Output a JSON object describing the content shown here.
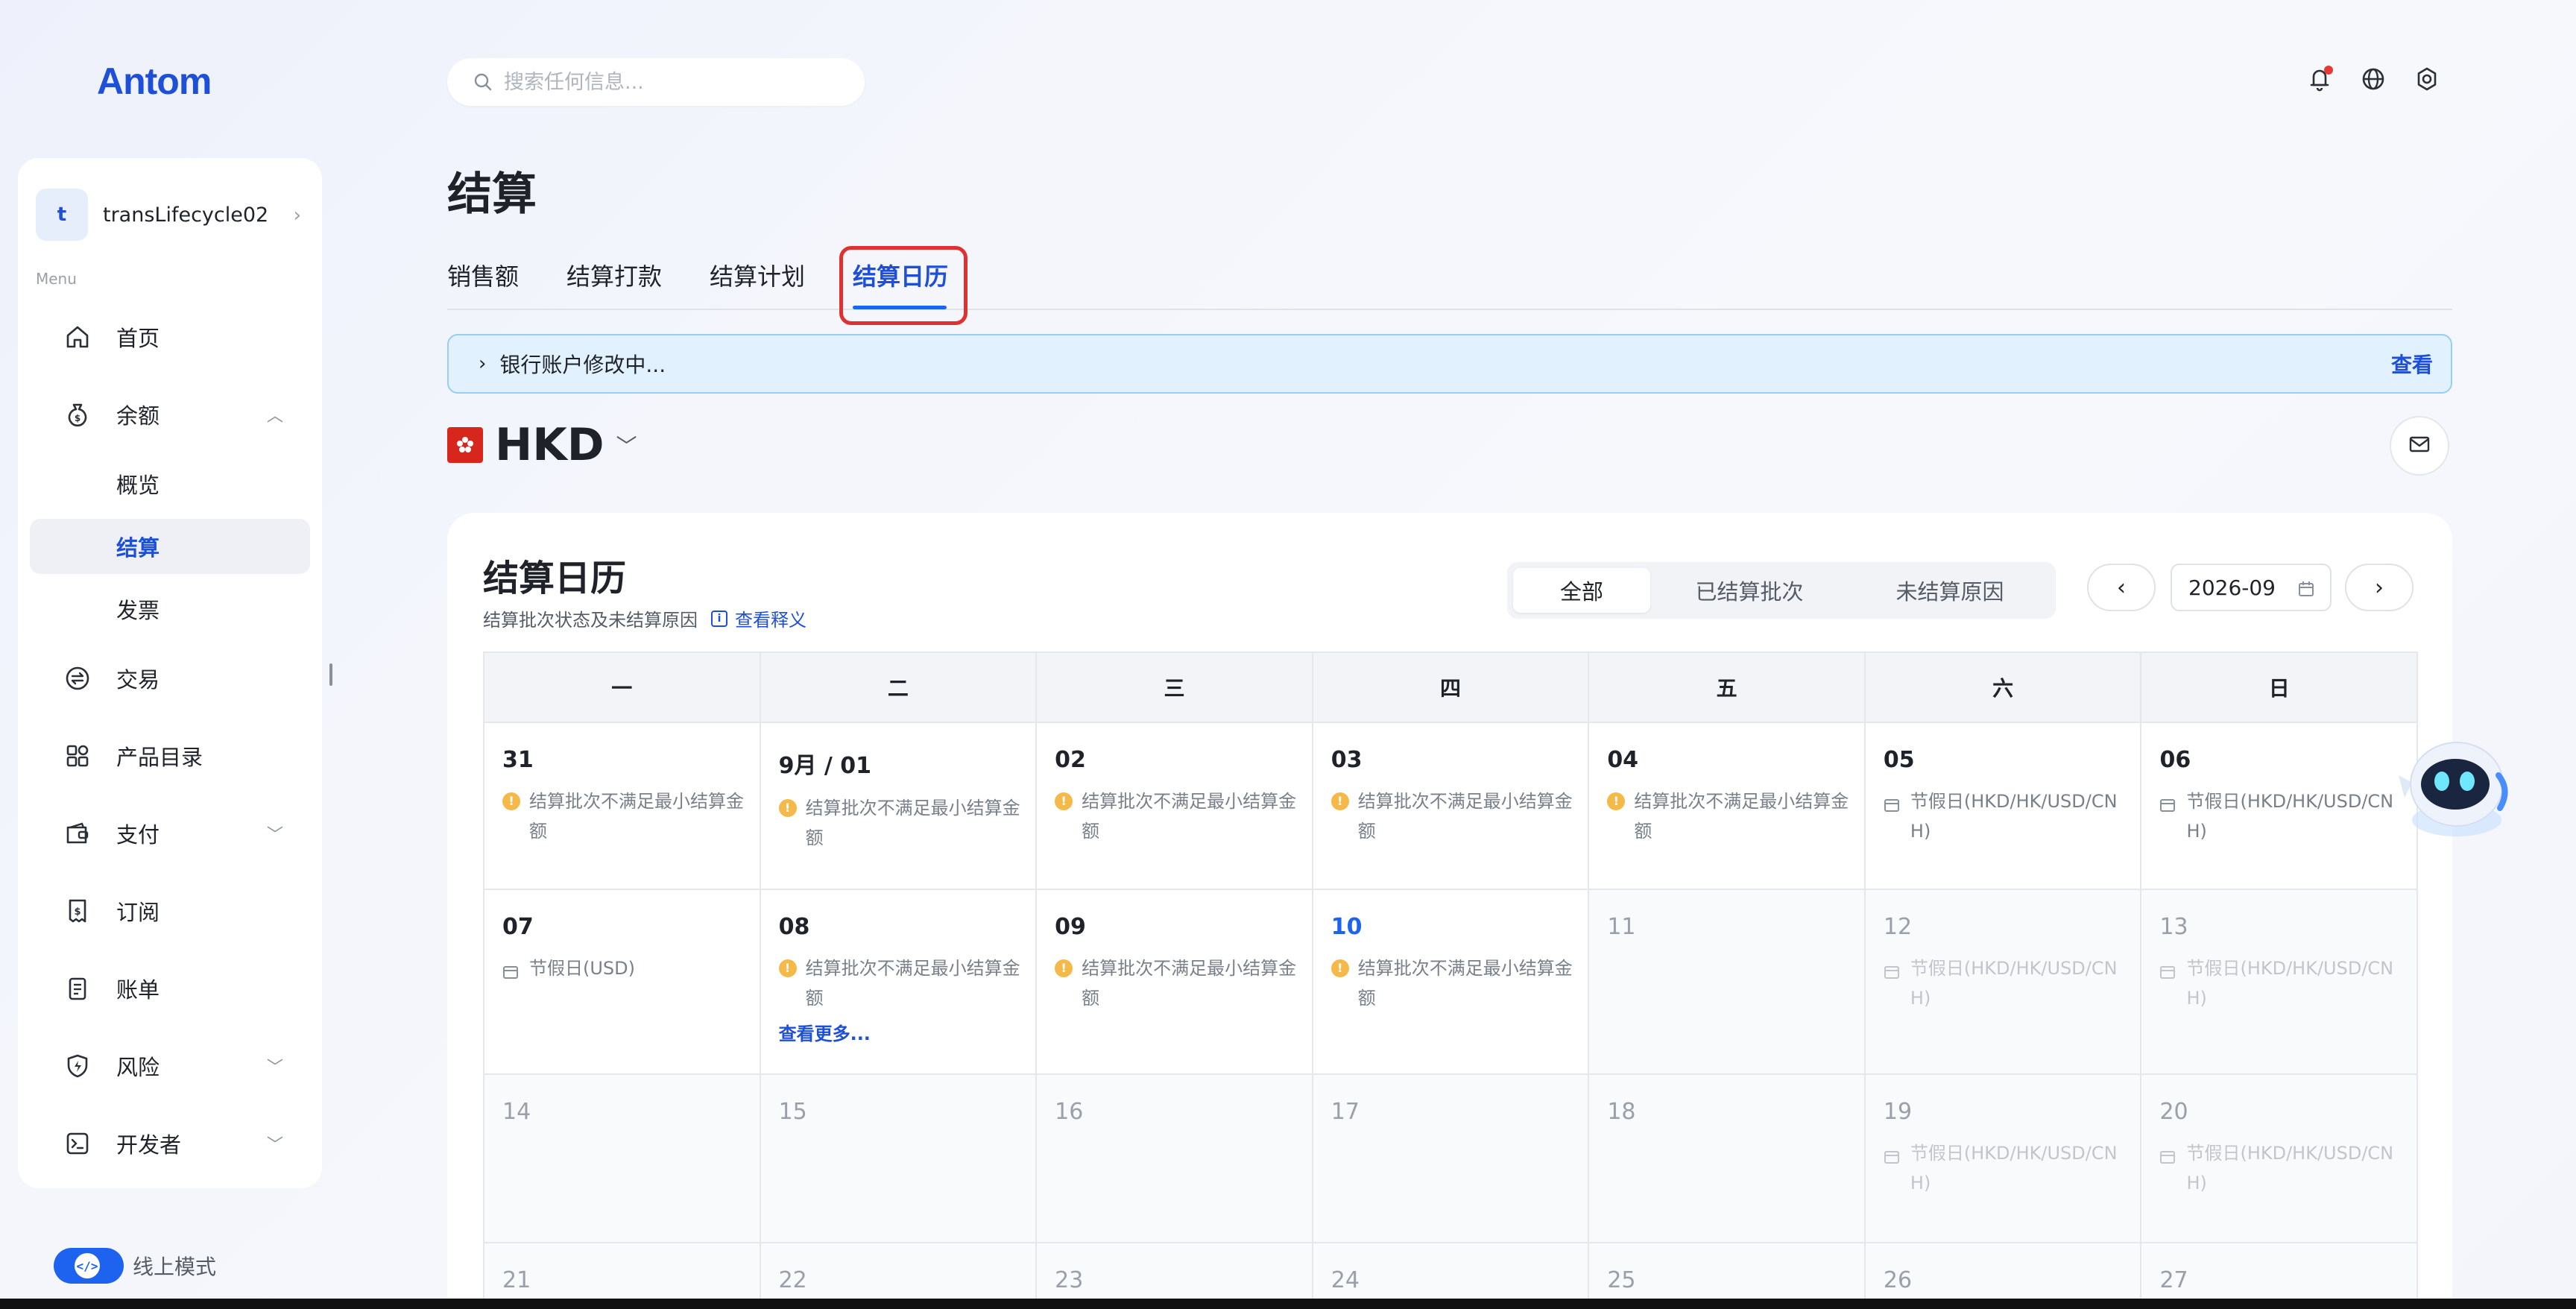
{
  "brand": {
    "logo_text": "Antom"
  },
  "header": {
    "search_placeholder": "搜索任何信息...",
    "icons": [
      "bell-icon",
      "globe-icon",
      "gear-icon"
    ]
  },
  "sidebar": {
    "account": {
      "avatar": "t",
      "name": "transLifecycle02"
    },
    "menu_title": "Menu",
    "items": [
      {
        "label": "首页",
        "icon": "home-icon"
      },
      {
        "label": "余额",
        "icon": "money-bag-icon",
        "expanded": true
      },
      {
        "label": "概览",
        "sub": true
      },
      {
        "label": "结算",
        "sub": true,
        "active": true
      },
      {
        "label": "发票",
        "sub": true
      },
      {
        "label": "交易",
        "icon": "exchange-icon"
      },
      {
        "label": "产品目录",
        "icon": "grid-icon"
      },
      {
        "label": "支付",
        "icon": "wallet-icon",
        "collapsible": true
      },
      {
        "label": "订阅",
        "icon": "subscription-icon"
      },
      {
        "label": "账单",
        "icon": "bill-icon"
      },
      {
        "label": "风险",
        "icon": "shield-icon",
        "collapsible": true
      },
      {
        "label": "开发者",
        "icon": "terminal-icon",
        "collapsible": true
      }
    ],
    "mode_label": "线上模式"
  },
  "page": {
    "title": "结算",
    "tabs": [
      "销售额",
      "结算打款",
      "结算计划",
      "结算日历"
    ],
    "active_tab": "结算日历",
    "banner": {
      "text": "银行账户修改中...",
      "link": "查看"
    },
    "currency": "HKD"
  },
  "calendar": {
    "title": "结算日历",
    "subtitle": "结算批次状态及未结算原因",
    "explain_link": "查看释义",
    "filters": [
      "全部",
      "已结算批次",
      "未结算原因"
    ],
    "active_filter": "全部",
    "month": "2026-09",
    "weekdays": [
      "一",
      "二",
      "三",
      "四",
      "五",
      "六",
      "日"
    ],
    "more_link": "查看更多...",
    "weeks": [
      [
        {
          "day": "31",
          "status": "warn",
          "text": "结算批次不满足最小结算金额"
        },
        {
          "day": "9月 / 01",
          "status": "warn",
          "text": "结算批次不满足最小结算金额"
        },
        {
          "day": "02",
          "status": "warn",
          "text": "结算批次不满足最小结算金额"
        },
        {
          "day": "03",
          "status": "warn",
          "text": "结算批次不满足最小结算金额"
        },
        {
          "day": "04",
          "status": "warn",
          "text": "结算批次不满足最小结算金额"
        },
        {
          "day": "05",
          "status": "holiday",
          "text": "节假日(HKD/HK/USD/CNH)"
        },
        {
          "day": "06",
          "status": "holiday",
          "text": "节假日(HKD/HK/USD/CNH)"
        }
      ],
      [
        {
          "day": "07",
          "status": "holiday",
          "text": "节假日(USD)"
        },
        {
          "day": "08",
          "status": "warn",
          "text": "结算批次不满足最小结算金额",
          "more": true
        },
        {
          "day": "09",
          "status": "warn",
          "text": "结算批次不满足最小结算金额"
        },
        {
          "day": "10",
          "status": "warn",
          "text": "结算批次不满足最小结算金额",
          "today": true
        },
        {
          "day": "11",
          "future": true
        },
        {
          "day": "12",
          "status": "holiday",
          "text": "节假日(HKD/HK/USD/CNH)",
          "future": true
        },
        {
          "day": "13",
          "status": "holiday",
          "text": "节假日(HKD/HK/USD/CNH)",
          "future": true
        }
      ],
      [
        {
          "day": "14",
          "future": true
        },
        {
          "day": "15",
          "future": true
        },
        {
          "day": "16",
          "future": true
        },
        {
          "day": "17",
          "future": true
        },
        {
          "day": "18",
          "future": true
        },
        {
          "day": "19",
          "status": "holiday",
          "text": "节假日(HKD/HK/USD/CNH)",
          "future": true
        },
        {
          "day": "20",
          "status": "holiday",
          "text": "节假日(HKD/HK/USD/CNH)",
          "future": true
        }
      ],
      [
        {
          "day": "21",
          "future": true
        },
        {
          "day": "22",
          "future": true
        },
        {
          "day": "23",
          "future": true
        },
        {
          "day": "24",
          "future": true
        },
        {
          "day": "25",
          "future": true
        },
        {
          "day": "26",
          "future": true
        },
        {
          "day": "27",
          "future": true
        }
      ]
    ]
  },
  "colors": {
    "accent": "#1d63f0",
    "brand": "#1d4fd8",
    "warning": "#f5b94a",
    "highlight_box": "#e03131"
  }
}
